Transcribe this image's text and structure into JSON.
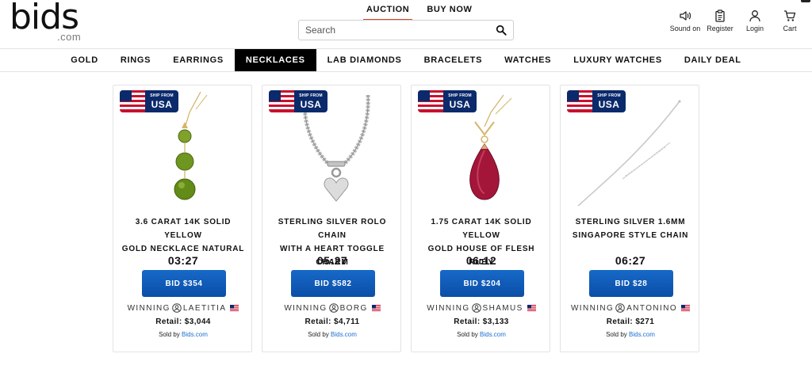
{
  "logo": {
    "word": "bids",
    "suffix": ".com"
  },
  "mode_tabs": [
    {
      "label": "AUCTION",
      "active": true
    },
    {
      "label": "BUY NOW",
      "active": false
    }
  ],
  "search": {
    "placeholder": "Search",
    "value": ""
  },
  "utilities": [
    {
      "label": "Sound on",
      "icon": "speaker-icon"
    },
    {
      "label": "Register",
      "icon": "clipboard-icon"
    },
    {
      "label": "Login",
      "icon": "user-icon"
    },
    {
      "label": "Cart",
      "icon": "cart-icon"
    }
  ],
  "categories": [
    {
      "label": "GOLD",
      "active": false
    },
    {
      "label": "RINGS",
      "active": false
    },
    {
      "label": "EARRINGS",
      "active": false
    },
    {
      "label": "NECKLACES",
      "active": true
    },
    {
      "label": "LAB DIAMONDS",
      "active": false
    },
    {
      "label": "BRACELETS",
      "active": false
    },
    {
      "label": "WATCHES",
      "active": false
    },
    {
      "label": "LUXURY WATCHES",
      "active": false
    },
    {
      "label": "DAILY DEAL",
      "active": false
    }
  ],
  "badge": {
    "line1": "SHIP FROM",
    "line2": "USA"
  },
  "products": [
    {
      "title_line1": "3.6 CARAT 14K SOLID YELLOW",
      "title_line2": "GOLD NECKLACE NATURAL",
      "timer": "03:27",
      "bid": "BID $354",
      "winning_label": "WINNING",
      "winner": "LAETITIA",
      "retail": "Retail:  $3,044",
      "sold_by": "Sold by",
      "seller": "Bids.com",
      "image": "peridot-drop-necklace",
      "color": "#6a8f1c"
    },
    {
      "title_line1": "STERLING SILVER ROLO CHAIN",
      "title_line2": "WITH A HEART TOGGLE CHARM",
      "timer": "05:27",
      "bid": "BID $582",
      "winning_label": "WINNING",
      "winner": "BORG",
      "retail": "Retail:  $4,711",
      "sold_by": "Sold by",
      "seller": "Bids.com",
      "image": "silver-rolo-heart-chain",
      "color": "#b8b8b8"
    },
    {
      "title_line1": "1.75 CARAT 14K SOLID YELLOW",
      "title_line2": "GOLD HOUSE OF FLESH RUBY",
      "timer": "06:12",
      "bid": "BID $204",
      "winning_label": "WINNING",
      "winner": "SHAMUS",
      "retail": "Retail:  $3,133",
      "sold_by": "Sold by",
      "seller": "Bids.com",
      "image": "ruby-pear-pendant",
      "color": "#9e1336"
    },
    {
      "title_line1": "STERLING SILVER 1.6MM",
      "title_line2": "SINGAPORE STYLE CHAIN",
      "timer": "06:27",
      "bid": "BID $28",
      "winning_label": "WINNING",
      "winner": "ANTONINO",
      "retail": "Retail:  $271",
      "sold_by": "Sold by",
      "seller": "Bids.com",
      "image": "silver-singapore-chain",
      "color": "#cfcfcf"
    }
  ],
  "colors": {
    "accent_red": "#e0412a",
    "button_blue": "#0b4ea6",
    "badge_navy": "#0b2a6b",
    "link_blue": "#1a6fd0"
  }
}
